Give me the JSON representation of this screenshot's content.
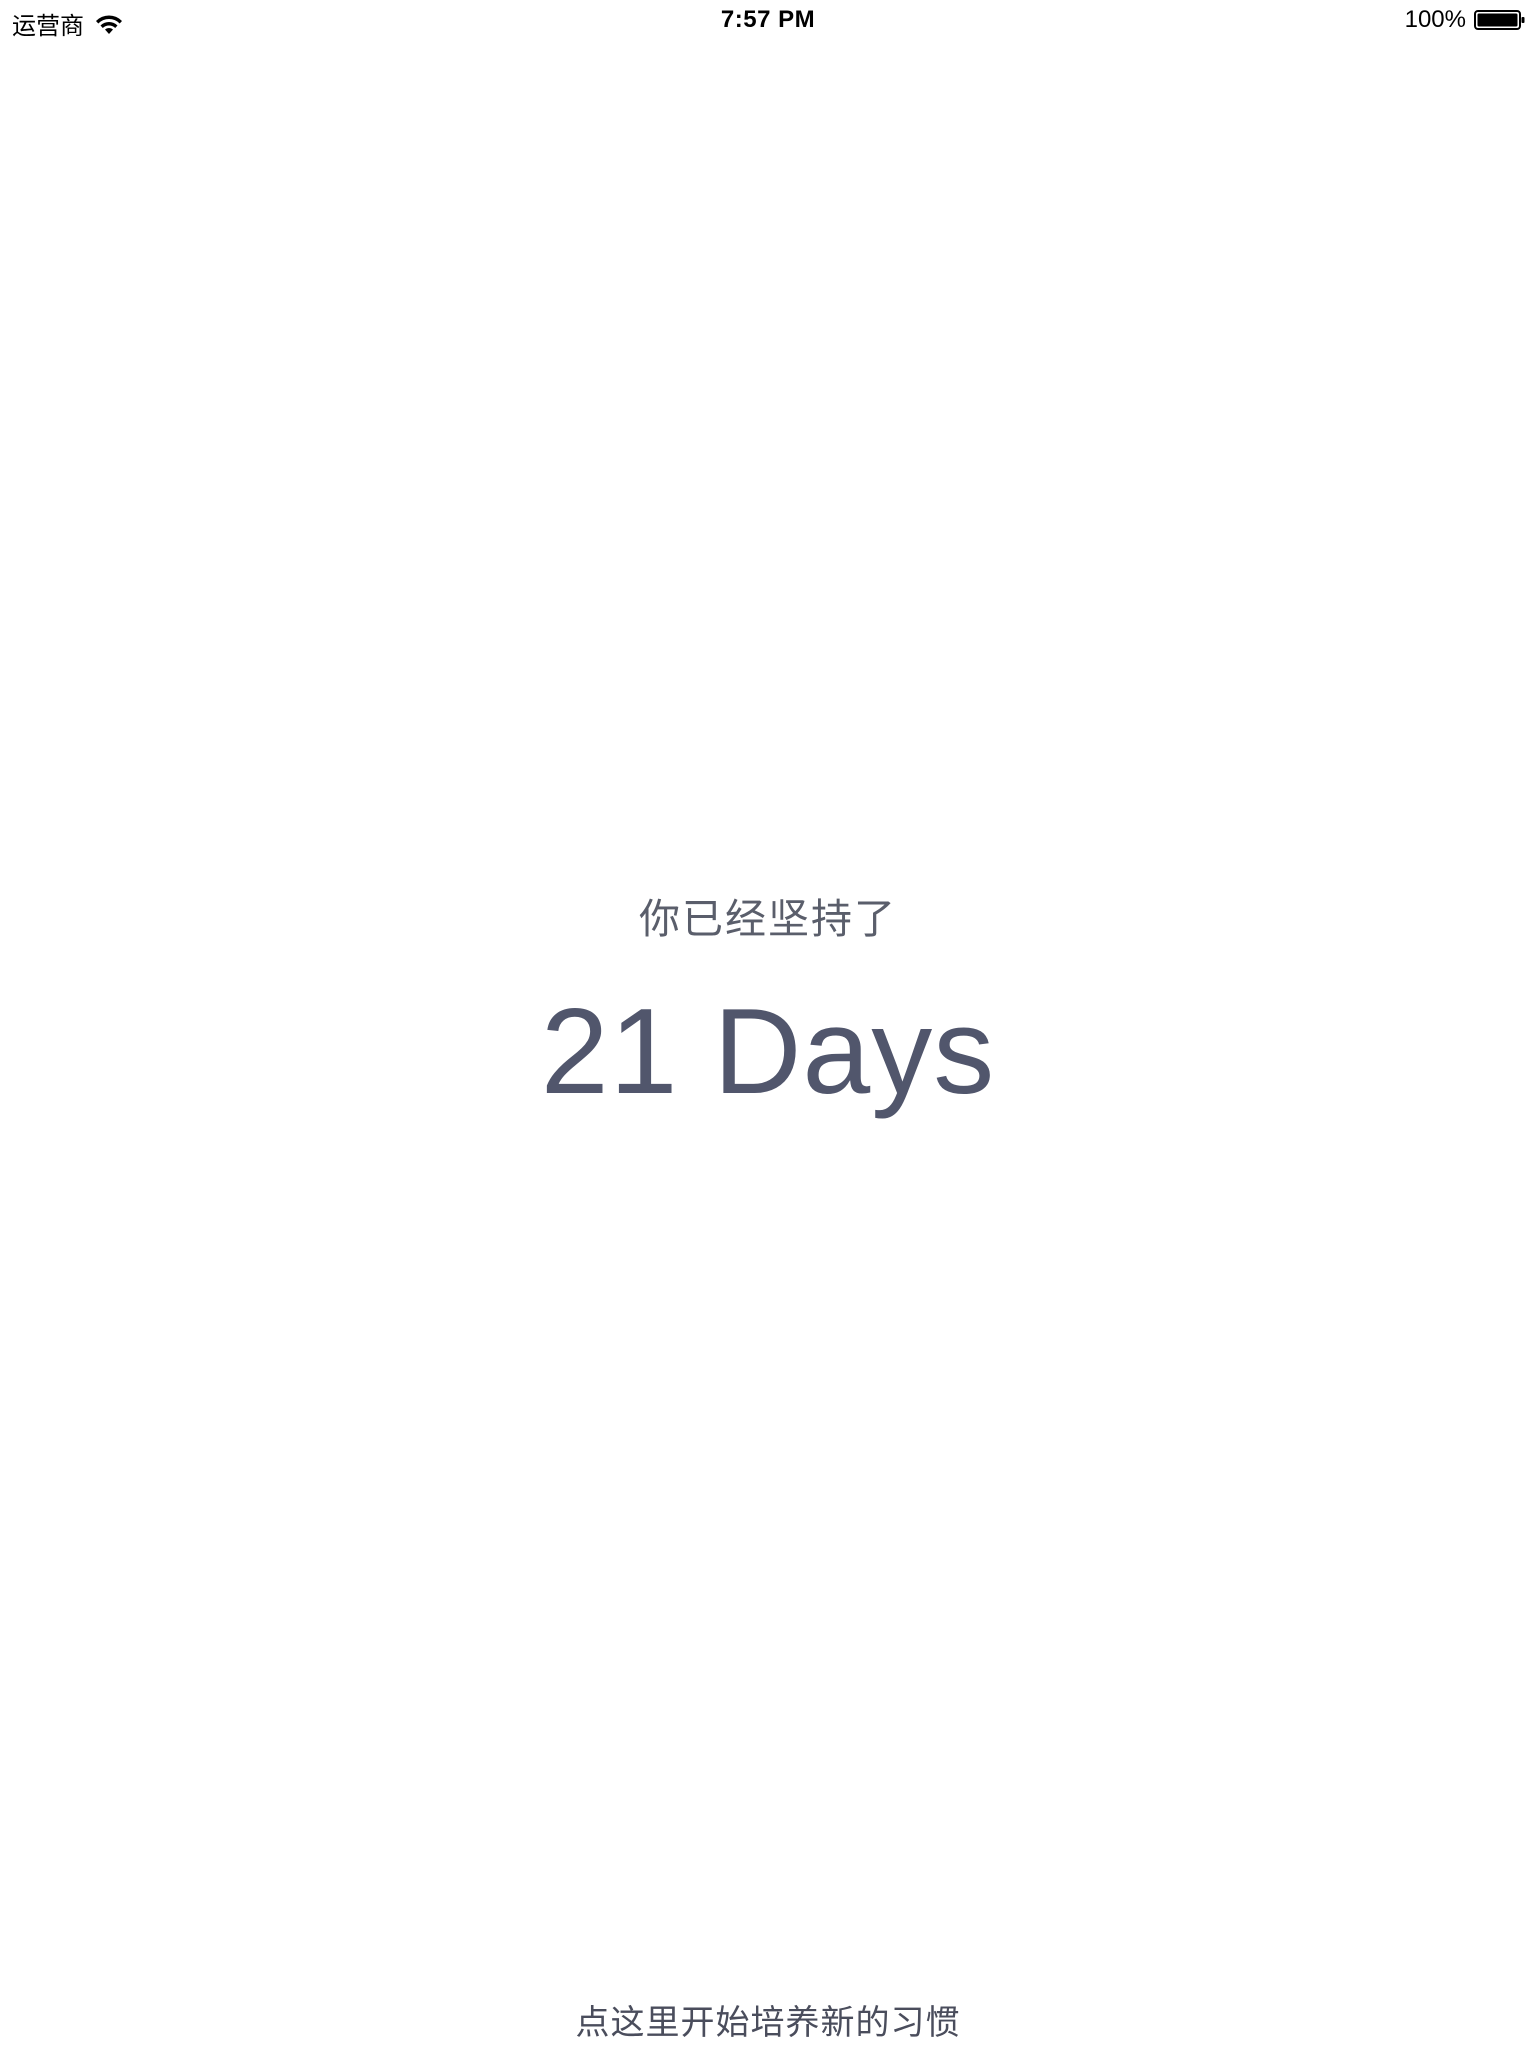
{
  "status_bar": {
    "carrier": "运营商",
    "wifi_icon": "wifi-icon",
    "time": "7:57 PM",
    "battery_percent": "100%",
    "battery_level": 1.0,
    "battery_icon": "battery-icon"
  },
  "main": {
    "headline": "你已经坚持了",
    "days": "21 Days",
    "start_new_habit": "点这里开始培养新的习惯"
  },
  "colors": {
    "text_primary": "#51566c",
    "text_secondary": "#5a5e6b",
    "background": "#ffffff"
  }
}
